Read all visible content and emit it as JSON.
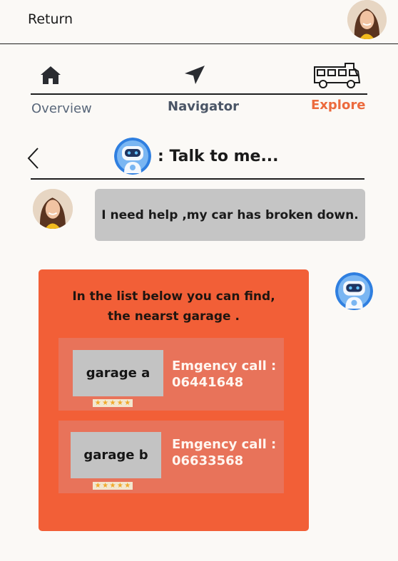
{
  "header": {
    "return_label": "Return",
    "avatar_icon": "user-avatar-woman"
  },
  "tabs": [
    {
      "label": "Overview",
      "icon": "home-icon",
      "active": false
    },
    {
      "label": "Navigator",
      "icon": "navigation-arrow-icon",
      "active": false
    },
    {
      "label": "Explore",
      "icon": "camper-van-icon",
      "active": true
    }
  ],
  "chat": {
    "back_icon": "chevron-left-icon",
    "title": ": Talk to me...",
    "bot_icon": "robot-avatar",
    "user_message": "I need help ,my car has broken down.",
    "bot_reply_line1": "In the list below you can find,",
    "bot_reply_line2": "the nearst garage .",
    "garages": [
      {
        "name": "garage a",
        "emergency_label": "Emgency call :",
        "phone": "06441648",
        "rating": 5
      },
      {
        "name": "garage b",
        "emergency_label": "Emgency call :",
        "phone": "06633568",
        "rating": 5
      }
    ]
  },
  "colors": {
    "accent": "#f25f37",
    "explore_active": "#ec6a3d",
    "bubble_gray": "#c5c5c5",
    "garage_item": "#e8735a"
  }
}
